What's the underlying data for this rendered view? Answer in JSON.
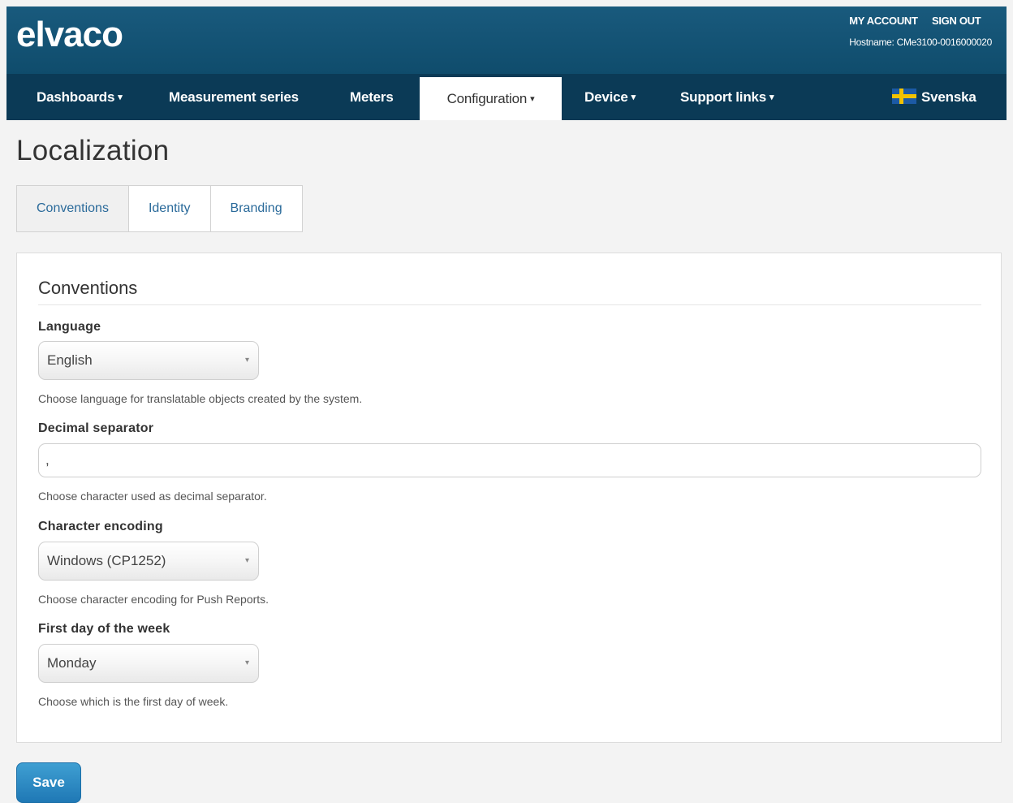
{
  "brand": {
    "logo_text": "elvaco"
  },
  "header": {
    "links": [
      "MY ACCOUNT",
      "SIGN OUT"
    ],
    "hostname": "Hostname: CMe3100-0016000020"
  },
  "nav": {
    "items": [
      {
        "label": "Dashboards",
        "has_caret": true
      },
      {
        "label": "Measurement series",
        "has_caret": false
      },
      {
        "label": "Meters",
        "has_caret": false
      },
      {
        "label": "Configuration",
        "has_caret": true,
        "active": true
      },
      {
        "label": "Device",
        "has_caret": true
      },
      {
        "label": "Support links",
        "has_caret": true
      }
    ],
    "language_switch": {
      "label": "Svenska",
      "icon": "swedish-flag-icon"
    },
    "caret": "▾"
  },
  "page": {
    "title": "Localization"
  },
  "tabs": [
    {
      "label": "Conventions",
      "active": true
    },
    {
      "label": "Identity",
      "active": false
    },
    {
      "label": "Branding",
      "active": false
    }
  ],
  "panel": {
    "title": "Conventions",
    "language": {
      "label": "Language",
      "value": "English",
      "help": "Choose language for translatable objects created by the system."
    },
    "decimal_separator": {
      "label": "Decimal separator",
      "value": ",",
      "help": "Choose character used as decimal separator."
    },
    "character_encoding": {
      "label": "Character encoding",
      "value": "Windows (CP1252)",
      "help": "Choose character encoding for Push Reports."
    },
    "first_day": {
      "label": "First day of the week",
      "value": "Monday",
      "help": "Choose which is the first day of week."
    }
  },
  "actions": {
    "save_label": "Save"
  },
  "colors": {
    "header_bg": "#0f4c6c",
    "navbar_bg": "#0b3a56",
    "link": "#2a6a9a",
    "save_button": "#2b88c3"
  }
}
